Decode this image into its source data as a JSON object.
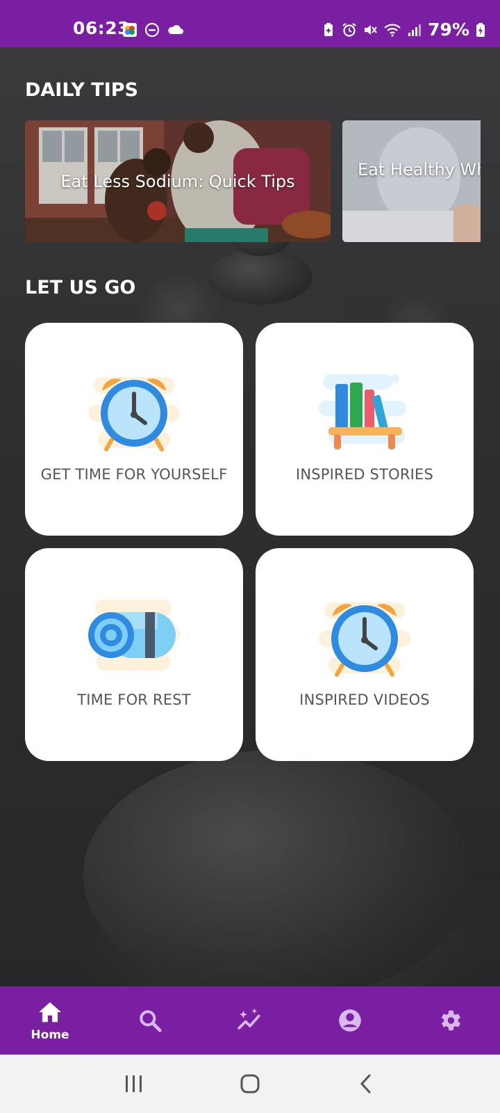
{
  "status_bar": {
    "time": "06:23",
    "battery": "79%",
    "left_icons": [
      "photos-icon",
      "dnd-icon",
      "cloud-icon"
    ],
    "right_icons": [
      "battery-saver-icon",
      "alarm-icon",
      "mute-icon",
      "wifi-icon",
      "signal-icon",
      "battery-icon"
    ]
  },
  "daily_tips": {
    "title": "DAILY TIPS",
    "tips": [
      {
        "label": "Eat Less Sodium: Quick Tips"
      },
      {
        "label": "Eat Healthy While"
      }
    ]
  },
  "let_us_go": {
    "title": "LET US GO",
    "cards": [
      {
        "label": "GET TIME FOR YOURSELF",
        "icon": "alarm-clock-icon"
      },
      {
        "label": "INSPIRED STORIES",
        "icon": "bookshelf-icon"
      },
      {
        "label": "TIME FOR REST",
        "icon": "yoga-mat-icon"
      },
      {
        "label": "INSPIRED VIDEOS",
        "icon": "alarm-clock-icon"
      }
    ]
  },
  "bottom_nav": {
    "items": [
      {
        "label": "Home",
        "icon": "home-icon",
        "active": true
      },
      {
        "label": "",
        "icon": "search-icon"
      },
      {
        "label": "",
        "icon": "sparkle-chart-icon"
      },
      {
        "label": "",
        "icon": "account-icon"
      },
      {
        "label": "",
        "icon": "gear-icon"
      }
    ]
  },
  "colors": {
    "brand": "#7b1fa2",
    "card_bg": "#ffffff",
    "card_text": "#555555",
    "system_nav_bg": "#f2f2f2"
  }
}
